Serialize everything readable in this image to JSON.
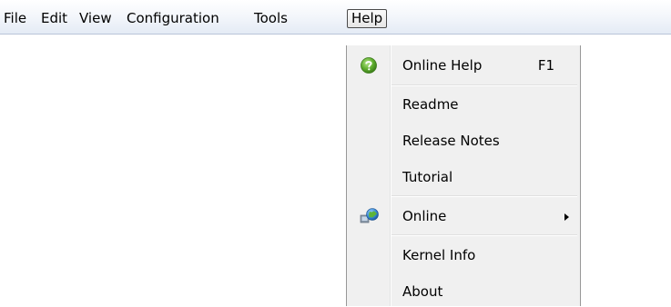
{
  "menubar": {
    "items": [
      {
        "label": "File"
      },
      {
        "label": "Edit"
      },
      {
        "label": "View"
      },
      {
        "label": "Configuration"
      },
      {
        "label": "Tools"
      },
      {
        "label": "Help"
      }
    ],
    "active_item": "Help"
  },
  "help_menu": {
    "items": [
      {
        "label": "Online Help",
        "shortcut": "F1",
        "icon": "help-question-icon"
      },
      {
        "label": "Readme"
      },
      {
        "label": "Release Notes"
      },
      {
        "label": "Tutorial"
      },
      {
        "label": "Online",
        "has_submenu": true,
        "icon": "globe-network-icon"
      },
      {
        "label": "Kernel Info"
      },
      {
        "label": "About"
      }
    ]
  }
}
